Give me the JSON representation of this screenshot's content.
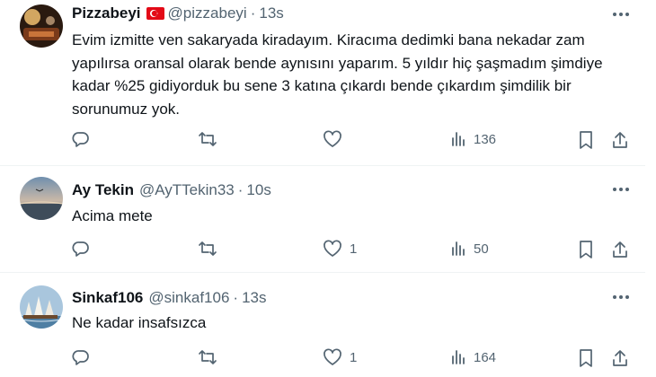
{
  "tweets": [
    {
      "name": "Pizzabeyi",
      "has_flag": true,
      "flag_icon": "turkey-flag",
      "handle": "@pizzabeyi",
      "separator": "·",
      "time": "13s",
      "text": "Evim izmitte ven sakaryada kiradayım. Kiracıma dedimki bana nekadar zam yapılırsa oransal olarak bende aynısını yaparım. 5 yıldır hiç şaşmadım şimdiye kadar %25 gidiyorduk bu sene 3 katına çıkardı bende çıkardım şimdilik bir sorunumuz yok.",
      "replies": "",
      "retweets": "",
      "likes": "",
      "views": "136"
    },
    {
      "name": "Ay Tekin",
      "handle": "@AyTTekin33",
      "separator": "·",
      "time": "10s",
      "text": "Acima mete",
      "replies": "",
      "retweets": "",
      "likes": "1",
      "views": "50"
    },
    {
      "name": "Sinkaf106",
      "handle": "@sinkaf106",
      "separator": "·",
      "time": "13s",
      "text": "Ne kadar insafsızca",
      "replies": "",
      "retweets": "",
      "likes": "1",
      "views": "164"
    }
  ],
  "icons": {
    "more": "more-icon",
    "reply": "reply-icon",
    "retweet": "retweet-icon",
    "like": "like-icon",
    "views": "views-icon",
    "bookmark": "bookmark-icon",
    "share": "share-icon"
  },
  "colors": {
    "text": "#0f1419",
    "secondary": "#536471",
    "divider": "#eff3f4",
    "flag_red": "#e30a17"
  }
}
